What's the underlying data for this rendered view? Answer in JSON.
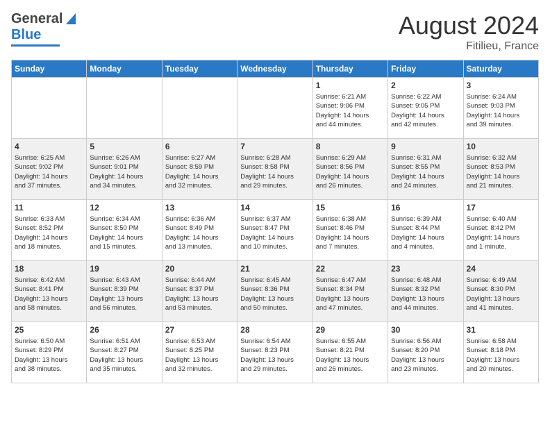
{
  "header": {
    "logo_general": "General",
    "logo_blue": "Blue",
    "title": "August 2024",
    "subtitle": "Fitilieu, France"
  },
  "days_of_week": [
    "Sunday",
    "Monday",
    "Tuesday",
    "Wednesday",
    "Thursday",
    "Friday",
    "Saturday"
  ],
  "weeks": [
    [
      {
        "day": "",
        "info": ""
      },
      {
        "day": "",
        "info": ""
      },
      {
        "day": "",
        "info": ""
      },
      {
        "day": "",
        "info": ""
      },
      {
        "day": "1",
        "info": "Sunrise: 6:21 AM\nSunset: 9:06 PM\nDaylight: 14 hours\nand 44 minutes."
      },
      {
        "day": "2",
        "info": "Sunrise: 6:22 AM\nSunset: 9:05 PM\nDaylight: 14 hours\nand 42 minutes."
      },
      {
        "day": "3",
        "info": "Sunrise: 6:24 AM\nSunset: 9:03 PM\nDaylight: 14 hours\nand 39 minutes."
      }
    ],
    [
      {
        "day": "4",
        "info": "Sunrise: 6:25 AM\nSunset: 9:02 PM\nDaylight: 14 hours\nand 37 minutes."
      },
      {
        "day": "5",
        "info": "Sunrise: 6:26 AM\nSunset: 9:01 PM\nDaylight: 14 hours\nand 34 minutes."
      },
      {
        "day": "6",
        "info": "Sunrise: 6:27 AM\nSunset: 8:59 PM\nDaylight: 14 hours\nand 32 minutes."
      },
      {
        "day": "7",
        "info": "Sunrise: 6:28 AM\nSunset: 8:58 PM\nDaylight: 14 hours\nand 29 minutes."
      },
      {
        "day": "8",
        "info": "Sunrise: 6:29 AM\nSunset: 8:56 PM\nDaylight: 14 hours\nand 26 minutes."
      },
      {
        "day": "9",
        "info": "Sunrise: 6:31 AM\nSunset: 8:55 PM\nDaylight: 14 hours\nand 24 minutes."
      },
      {
        "day": "10",
        "info": "Sunrise: 6:32 AM\nSunset: 8:53 PM\nDaylight: 14 hours\nand 21 minutes."
      }
    ],
    [
      {
        "day": "11",
        "info": "Sunrise: 6:33 AM\nSunset: 8:52 PM\nDaylight: 14 hours\nand 18 minutes."
      },
      {
        "day": "12",
        "info": "Sunrise: 6:34 AM\nSunset: 8:50 PM\nDaylight: 14 hours\nand 15 minutes."
      },
      {
        "day": "13",
        "info": "Sunrise: 6:36 AM\nSunset: 8:49 PM\nDaylight: 14 hours\nand 13 minutes."
      },
      {
        "day": "14",
        "info": "Sunrise: 6:37 AM\nSunset: 8:47 PM\nDaylight: 14 hours\nand 10 minutes."
      },
      {
        "day": "15",
        "info": "Sunrise: 6:38 AM\nSunset: 8:46 PM\nDaylight: 14 hours\nand 7 minutes."
      },
      {
        "day": "16",
        "info": "Sunrise: 6:39 AM\nSunset: 8:44 PM\nDaylight: 14 hours\nand 4 minutes."
      },
      {
        "day": "17",
        "info": "Sunrise: 6:40 AM\nSunset: 8:42 PM\nDaylight: 14 hours\nand 1 minute."
      }
    ],
    [
      {
        "day": "18",
        "info": "Sunrise: 6:42 AM\nSunset: 8:41 PM\nDaylight: 13 hours\nand 58 minutes."
      },
      {
        "day": "19",
        "info": "Sunrise: 6:43 AM\nSunset: 8:39 PM\nDaylight: 13 hours\nand 56 minutes."
      },
      {
        "day": "20",
        "info": "Sunrise: 6:44 AM\nSunset: 8:37 PM\nDaylight: 13 hours\nand 53 minutes."
      },
      {
        "day": "21",
        "info": "Sunrise: 6:45 AM\nSunset: 8:36 PM\nDaylight: 13 hours\nand 50 minutes."
      },
      {
        "day": "22",
        "info": "Sunrise: 6:47 AM\nSunset: 8:34 PM\nDaylight: 13 hours\nand 47 minutes."
      },
      {
        "day": "23",
        "info": "Sunrise: 6:48 AM\nSunset: 8:32 PM\nDaylight: 13 hours\nand 44 minutes."
      },
      {
        "day": "24",
        "info": "Sunrise: 6:49 AM\nSunset: 8:30 PM\nDaylight: 13 hours\nand 41 minutes."
      }
    ],
    [
      {
        "day": "25",
        "info": "Sunrise: 6:50 AM\nSunset: 8:29 PM\nDaylight: 13 hours\nand 38 minutes."
      },
      {
        "day": "26",
        "info": "Sunrise: 6:51 AM\nSunset: 8:27 PM\nDaylight: 13 hours\nand 35 minutes."
      },
      {
        "day": "27",
        "info": "Sunrise: 6:53 AM\nSunset: 8:25 PM\nDaylight: 13 hours\nand 32 minutes."
      },
      {
        "day": "28",
        "info": "Sunrise: 6:54 AM\nSunset: 8:23 PM\nDaylight: 13 hours\nand 29 minutes."
      },
      {
        "day": "29",
        "info": "Sunrise: 6:55 AM\nSunset: 8:21 PM\nDaylight: 13 hours\nand 26 minutes."
      },
      {
        "day": "30",
        "info": "Sunrise: 6:56 AM\nSunset: 8:20 PM\nDaylight: 13 hours\nand 23 minutes."
      },
      {
        "day": "31",
        "info": "Sunrise: 6:58 AM\nSunset: 8:18 PM\nDaylight: 13 hours\nand 20 minutes."
      }
    ]
  ]
}
